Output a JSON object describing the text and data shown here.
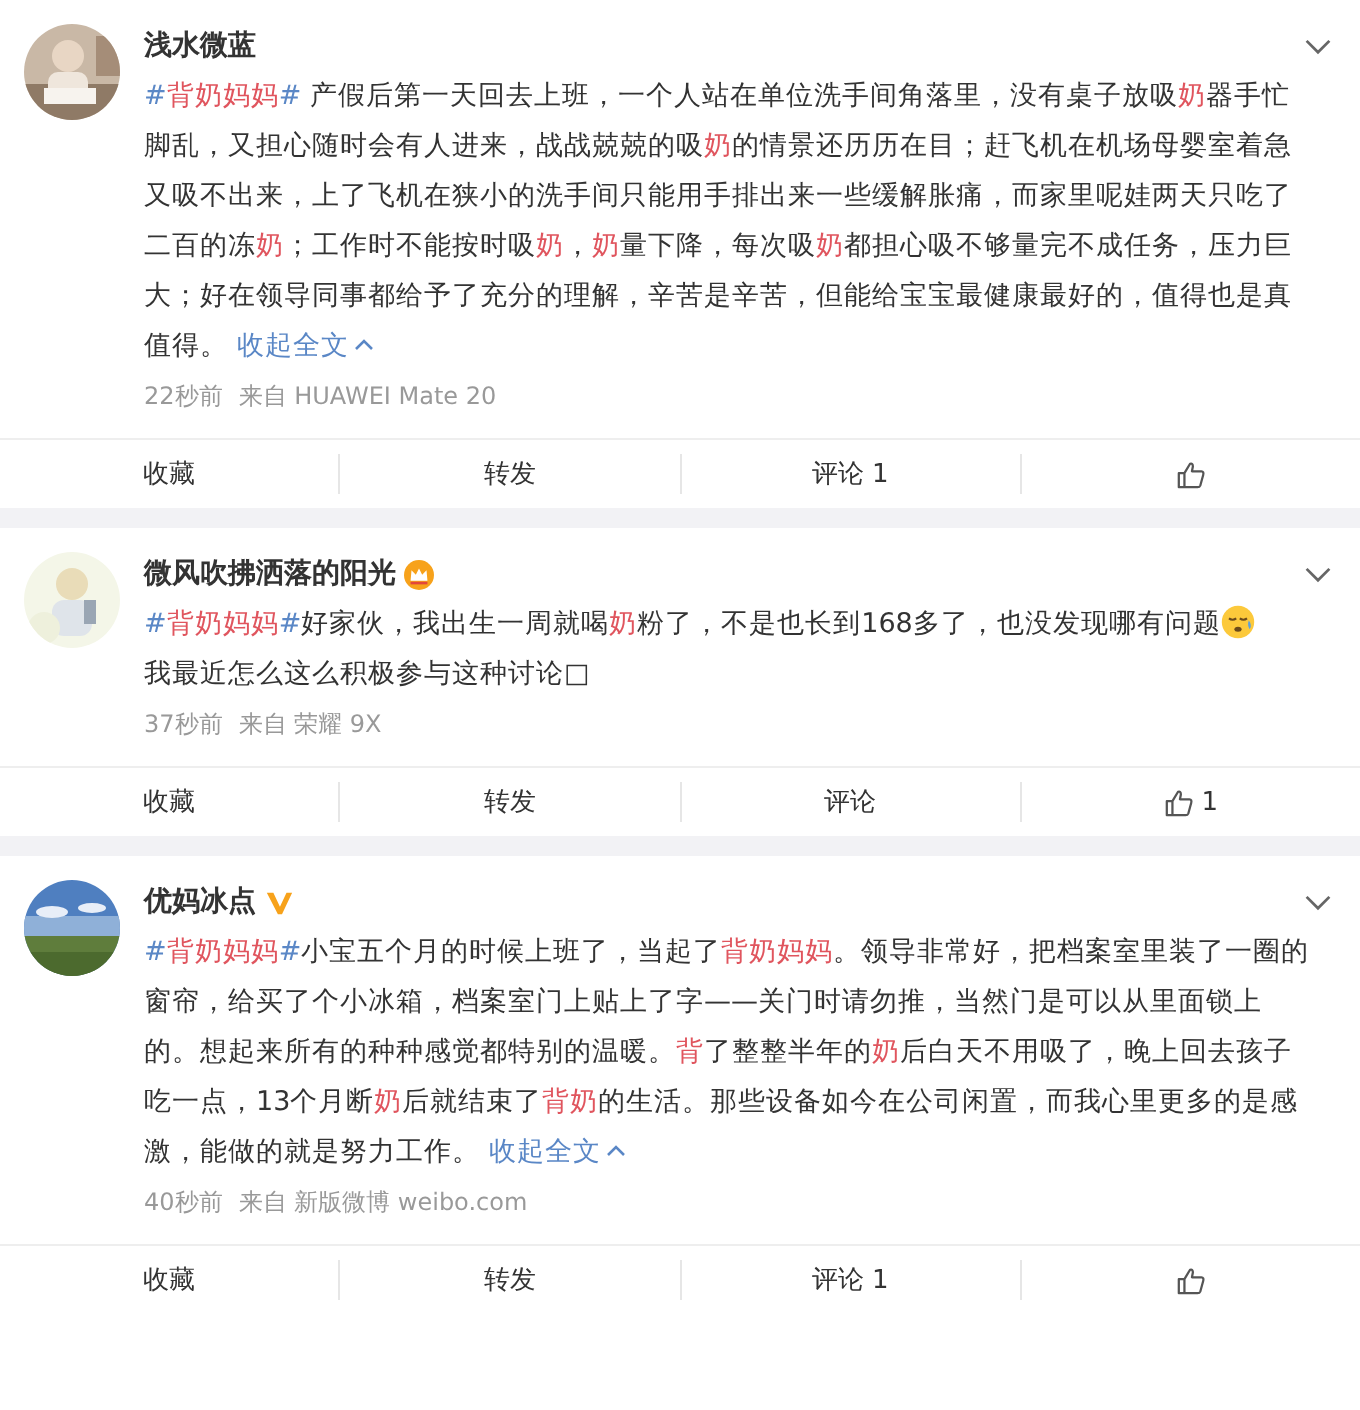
{
  "posts": [
    {
      "avatar": {
        "kind": "picture"
      },
      "name": "浅水微蓝",
      "paragraphs": [
        [
          {
            "kind": "tag",
            "t": "#"
          },
          {
            "kind": "hl",
            "t": "背奶妈妈"
          },
          {
            "kind": "tag",
            "t": "#"
          },
          {
            "kind": "plain",
            "t": " 产假后第一天回去上班，一个人站在单位洗手间角落里，没有桌子放吸"
          },
          {
            "kind": "hl",
            "t": "奶"
          },
          {
            "kind": "plain",
            "t": "器手忙脚乱，又担心随时会有人进来，战战兢兢的吸"
          },
          {
            "kind": "hl",
            "t": "奶"
          },
          {
            "kind": "plain",
            "t": "的情景还历历在目；赶飞机在机场母婴室着急又吸不出来，上了飞机在狭小的洗手间只能用手排出来一些缓解胀痛，而家里呢娃两天只吃了二百的冻"
          },
          {
            "kind": "hl",
            "t": "奶"
          },
          {
            "kind": "plain",
            "t": "；工作时不能按时吸"
          },
          {
            "kind": "hl",
            "t": "奶"
          },
          {
            "kind": "plain",
            "t": "，"
          },
          {
            "kind": "hl",
            "t": "奶"
          },
          {
            "kind": "plain",
            "t": "量下降，每次吸"
          },
          {
            "kind": "hl",
            "t": "奶"
          },
          {
            "kind": "plain",
            "t": "都担心吸不够量完不成任务，压力巨大；好在领导同事都给予了充分的理解，辛苦是辛苦，但能给宝宝最健康最好的，值得也是真值得。 "
          },
          {
            "kind": "link",
            "t": "收起全文"
          }
        ]
      ],
      "time": "22秒前",
      "source": "来自 HUAWEI Mate 20",
      "actions": [
        {
          "kind": "text",
          "label": "收藏"
        },
        {
          "kind": "text",
          "label": "转发"
        },
        {
          "kind": "text",
          "label": "评论 1"
        },
        {
          "kind": "like"
        }
      ]
    },
    {
      "avatar": {
        "kind": "picture"
      },
      "name": "微风吹拂洒落的阳光",
      "badge": {
        "kind": "crown"
      },
      "paragraphs": [
        [
          {
            "kind": "tag",
            "t": "#"
          },
          {
            "kind": "hl",
            "t": "背奶妈妈"
          },
          {
            "kind": "tag",
            "t": "#"
          },
          {
            "kind": "plain",
            "t": "好家伙，我出生一周就喝"
          },
          {
            "kind": "hl",
            "t": "奶"
          },
          {
            "kind": "plain",
            "t": "粉了，不是也长到168多了，也没发现哪有问题"
          },
          {
            "kind": "emoji"
          }
        ],
        [
          {
            "kind": "plain",
            "t": "我最近怎么这么积极参与这种讨论□"
          }
        ]
      ],
      "time": "37秒前",
      "source": "来自 荣耀 9X",
      "actions": [
        {
          "kind": "text",
          "label": "收藏"
        },
        {
          "kind": "text",
          "label": "转发"
        },
        {
          "kind": "text",
          "label": "评论"
        },
        {
          "kind": "like",
          "count": "1"
        }
      ]
    },
    {
      "avatar": {
        "kind": "picture"
      },
      "name": "优妈冰点",
      "badge": {
        "kind": "verified"
      },
      "paragraphs": [
        [
          {
            "kind": "tag",
            "t": "#"
          },
          {
            "kind": "hl",
            "t": "背奶妈妈"
          },
          {
            "kind": "tag",
            "t": "#"
          },
          {
            "kind": "plain",
            "t": "小宝五个月的时候上班了，当起了"
          },
          {
            "kind": "hl",
            "t": "背奶妈妈"
          },
          {
            "kind": "plain",
            "t": "。领导非常好，把档案室里装了一圈的窗帘，给买了个小冰箱，档案室门上贴上了字——关门时请勿推，当然门是可以从里面锁上的。想起来所有的种种感觉都特别的温暖。"
          },
          {
            "kind": "hl",
            "t": "背"
          },
          {
            "kind": "plain",
            "t": "了整整半年的"
          },
          {
            "kind": "hl",
            "t": "奶"
          },
          {
            "kind": "plain",
            "t": "后白天不用吸了，晚上回去孩子吃一点，13个月断"
          },
          {
            "kind": "hl",
            "t": "奶"
          },
          {
            "kind": "plain",
            "t": "后就结束了"
          },
          {
            "kind": "hl",
            "t": "背奶"
          },
          {
            "kind": "plain",
            "t": "的生活。那些设备如今在公司闲置，而我心里更多的是感激，能做的就是努力工作。 "
          },
          {
            "kind": "link",
            "t": "收起全文"
          }
        ]
      ],
      "time": "40秒前",
      "source": "来自 新版微博 weibo.com",
      "actions": [
        {
          "kind": "text",
          "label": "收藏"
        },
        {
          "kind": "text",
          "label": "转发"
        },
        {
          "kind": "text",
          "label": "评论 1"
        },
        {
          "kind": "like"
        }
      ]
    }
  ]
}
